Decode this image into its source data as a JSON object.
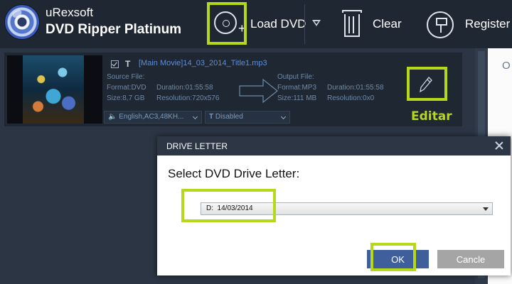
{
  "app": {
    "brand_company": "uRexsoft",
    "brand_product": "DVD Ripper Platinum"
  },
  "toolbar": {
    "load_dvd_label": "Load DVD",
    "clear_label": "Clear",
    "register_label": "Register"
  },
  "item": {
    "title": "[Main Movie]14_03_2014_Title1.mp3",
    "source": {
      "header": "Source File:",
      "format": "Format:DVD",
      "duration": "Duration:01:55:58",
      "size": "Size:8,7 GB",
      "resolution": "Resolution:720x576"
    },
    "output": {
      "header": "Output File:",
      "format": "Format:MP3",
      "duration": "Duration:01:55:58",
      "size": "Size:111 MB",
      "resolution": "Resolution:0x0"
    },
    "audio_track": "English,AC3,48KH...",
    "subtitle": "Disabled",
    "edit_annotation": "Editar"
  },
  "right_panel": {
    "partial_text": "O"
  },
  "dialog": {
    "title": "DRIVE LETTER",
    "prompt": "Select DVD Drive Letter:",
    "drive_value": "D:  14/03/2014",
    "ok_label": "OK",
    "cancel_label": "Cancle"
  },
  "colors": {
    "highlight": "#b5d81a",
    "ok_button": "#3e5f9b",
    "title_link": "#5f8ed6"
  }
}
